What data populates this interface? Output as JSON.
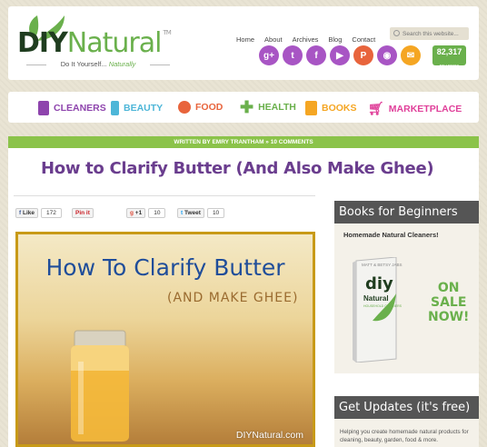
{
  "header": {
    "logo_diy": "DIY",
    "logo_natural": "Natural",
    "logo_tm": "TM",
    "tagline_prefix": "Do It Yourself...",
    "tagline_em": "Naturally",
    "nav": [
      "Home",
      "About",
      "Archives",
      "Blog",
      "Contact"
    ],
    "search_placeholder": "Search this website...",
    "social": [
      {
        "name": "google-plus-icon",
        "glyph": "g+",
        "color": "#a855c4"
      },
      {
        "name": "twitter-icon",
        "glyph": "t",
        "color": "#a855c4"
      },
      {
        "name": "facebook-icon",
        "glyph": "f",
        "color": "#a855c4"
      },
      {
        "name": "youtube-icon",
        "glyph": "▶",
        "color": "#a855c4"
      },
      {
        "name": "pinterest-icon",
        "glyph": "P",
        "color": "#e8643c"
      },
      {
        "name": "rss-icon",
        "glyph": "◉",
        "color": "#a855c4"
      },
      {
        "name": "email-icon",
        "glyph": "✉",
        "color": "#f5a623"
      }
    ],
    "readers_count": "82,317",
    "readers_label": "READERS"
  },
  "categories": [
    {
      "label": "CLEANERS",
      "color": "#8e44ad"
    },
    {
      "label": "BEAUTY",
      "color": "#4db6d8"
    },
    {
      "label": "FOOD",
      "color": "#e8643c"
    },
    {
      "label": "HEALTH",
      "color": "#6ab04c"
    },
    {
      "label": "BOOKS",
      "color": "#f5a623"
    },
    {
      "label": "MARKETPLACE",
      "color": "#e0409a"
    }
  ],
  "post": {
    "byline": "WRITTEN BY EMRY TRANTHAM » 10 COMMENTS",
    "title": "How to Clarify Butter (And Also Make Ghee)",
    "share": {
      "facebook_label": "Like",
      "facebook_count": "172",
      "pinterest_label": "Pin it",
      "gplus_label": "+1",
      "gplus_count": "10",
      "tweet_label": "Tweet",
      "tweet_count": "10"
    },
    "hero_title": "How To Clarify Butter",
    "hero_sub": "(AND MAKE GHEE)",
    "hero_brand": "DIYNatural.com"
  },
  "sidebar": {
    "books_heading": "Books for Beginners",
    "books_sub": "Homemade Natural Cleaners!",
    "book_authors": "MATT & BETSY JABS",
    "book_title": "diy",
    "book_natural": "Natural",
    "book_cleaners": "HOUSEHOLD CLEANERS",
    "onsale": [
      "ON",
      "SALE",
      "NOW!"
    ],
    "updates_heading": "Get Updates (it's free)",
    "updates_text": "Helping you create homemade natural products for cleaning, beauty, garden, food & more."
  }
}
